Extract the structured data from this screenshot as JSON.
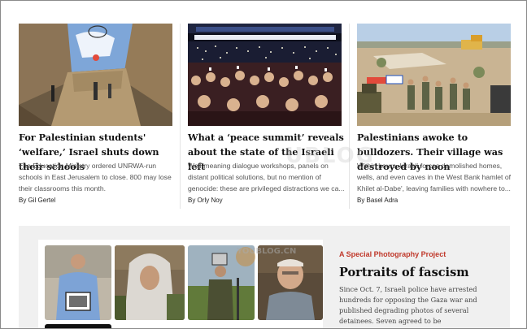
{
  "articles": [
    {
      "headline": "For Palestinian students' ‘welfare,’ Israel shuts down their schools",
      "excerpt": "The Education Ministry ordered UNRWA-run schools in East Jerusalem to close. 800 may lose their classrooms this month.",
      "byline": "By Gil Gertel"
    },
    {
      "headline": "What a ‘peace summit’ reveals about the state of the Israeli left",
      "excerpt": "Well-meaning dialogue workshops, panels on distant political solutions, but no mention of genocide: these are privileged distractions we ca...",
      "byline": "By Orly Noy"
    },
    {
      "headline": "Palestinians awoke to bulldozers. Their village was destroyed by noon",
      "excerpt": "Within hours, Israeli forces demolished homes, wells, and even caves in the West Bank hamlet of Khilet al-Dabe', leaving families with nowhere to...",
      "byline": "By Basel Adra"
    }
  ],
  "project": {
    "kicker": "A Special Photography Project",
    "title": "Portraits of fascism",
    "description": "Since Oct. 7, Israeli police have arrested hundreds for opposing the Gaza war and published degrading photos of several detainees. Seven agreed to be photographed"
  },
  "watermark": {
    "text": "UBLOG",
    "small": "YOUBLOG.CN"
  },
  "colors": {
    "kicker": "#c0392b",
    "project_bg": "#f0f0f0",
    "divider": "#e4e4e4"
  }
}
